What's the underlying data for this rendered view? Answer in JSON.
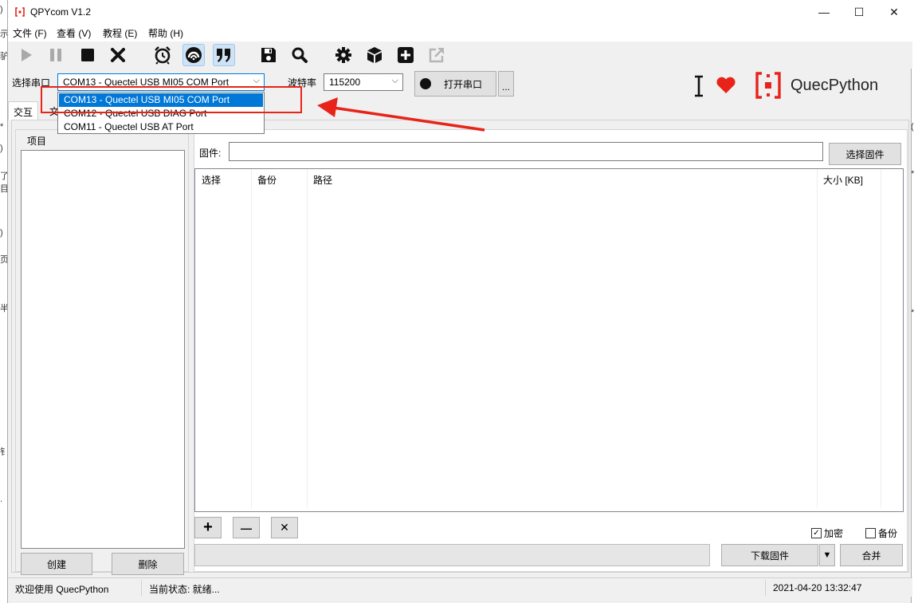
{
  "window": {
    "title": "QPYcom V1.2",
    "controls": [
      "—",
      "☐",
      "✕"
    ]
  },
  "menu": [
    "文件 (F)",
    "查看 (V)",
    "教程 (E)",
    "帮助 (H)"
  ],
  "toolbar_icons": [
    "play-icon",
    "pause-icon",
    "stop-icon",
    "close-icon",
    "alarm-clock-icon",
    "signal-icon",
    "quote-icon",
    "save-icon",
    "search-icon",
    "gear-icon",
    "cube-icon",
    "plus-square-icon",
    "external-link-icon"
  ],
  "serial": {
    "port_label": "选择串口",
    "port_value": "COM13 - Quectel USB MI05 COM Port",
    "port_options": [
      "COM13 - Quectel USB MI05 COM Port",
      "COM12 - Quectel USB DIAG Port",
      "COM11 - Quectel USB AT Port"
    ],
    "baud_label": "波特率",
    "baud_value": "115200",
    "open_label": "打开串口",
    "more_label": "..."
  },
  "brand": {
    "name": "QuecPython",
    "accent": "#e8231a"
  },
  "tabs": [
    "交互",
    "文"
  ],
  "projects": {
    "group_title": "项目",
    "create_label": "创建",
    "delete_label": "删除"
  },
  "firmware": {
    "label": "固件:",
    "value": "",
    "choose_label": "选择固件",
    "columns": [
      "选择",
      "备份",
      "路径",
      "大小 [KB]"
    ],
    "add_label": "+",
    "remove_label": "—",
    "clear_label": "✕",
    "encrypt_label": "加密",
    "encrypt_checked": true,
    "backup_label": "备份",
    "backup_checked": false,
    "download_label": "下载固件",
    "merge_label": "合并"
  },
  "status": {
    "welcome": "欢迎使用 QuecPython",
    "state": "当前状态: 就绪...",
    "datetime": "2021-04-20 13:32:47"
  },
  "background_text_left": [
    ")",
    "示",
    "驴",
    "*",
    ")",
    "了",
    "目",
    ")",
    "页",
    "半",
    "钅",
    "."
  ],
  "background_text_right": [
    "(",
    "*",
    "*"
  ]
}
